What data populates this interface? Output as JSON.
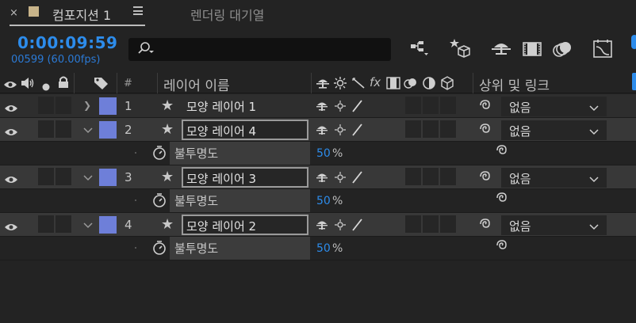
{
  "tabs": {
    "close_glyph": "×",
    "comp_title": "컴포지션 1",
    "render_queue": "렌더링 대기열"
  },
  "toolbar": {
    "timecode": "0:00:09:59",
    "frames": "00599 (60.00fps)",
    "search_placeholder": ""
  },
  "columns": {
    "hash": "#",
    "layer_name": "레이어 이름",
    "fx": "fx",
    "parent_link": "상위 및 링크"
  },
  "layers": [
    {
      "num": "1",
      "name": "모양 레이어 1",
      "parent": "없음",
      "expanded": false
    },
    {
      "num": "2",
      "name": "모양 레이어 4",
      "parent": "없음",
      "expanded": true,
      "prop": {
        "name": "불투명도",
        "value": "50",
        "unit": "%"
      }
    },
    {
      "num": "3",
      "name": "모양 레이어 3",
      "parent": "없음",
      "expanded": true,
      "prop": {
        "name": "불투명도",
        "value": "50",
        "unit": "%"
      }
    },
    {
      "num": "4",
      "name": "모양 레이어 2",
      "parent": "없음",
      "expanded": true,
      "prop": {
        "name": "불투명도",
        "value": "50",
        "unit": "%"
      }
    }
  ],
  "colors": {
    "accent": "#2d8ceb",
    "label_swatch": "#6e7fd9",
    "comp_swatch": "#c8b48a"
  },
  "icons": [
    "close-icon",
    "panel-menu-icon",
    "search-icon",
    "flowchart-icon",
    "draft-3d-icon",
    "shy-icon",
    "frame-blend-icon",
    "motion-blur-icon",
    "graph-editor-icon",
    "eye-icon",
    "audio-icon",
    "solo-icon",
    "lock-icon",
    "label-tag-icon",
    "stopwatch-icon",
    "pickwhip-icon",
    "star-icon",
    "chevron-down-icon"
  ]
}
